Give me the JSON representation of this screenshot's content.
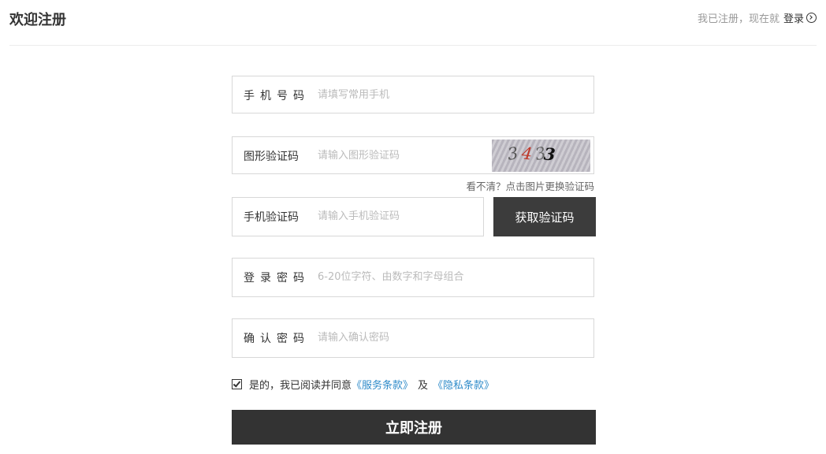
{
  "header": {
    "title": "欢迎注册",
    "login_prompt": "我已注册，现在就",
    "login_link": "登录",
    "login_icon": "arrow-circle-right-icon"
  },
  "form": {
    "phone": {
      "label": "手机号码",
      "placeholder": "请填写常用手机"
    },
    "captcha": {
      "label": "图形验证码",
      "placeholder": "请输入图形验证码",
      "image_text": "3433",
      "refresh_tip": "看不清？点击图片更换验证码"
    },
    "sms": {
      "label": "手机验证码",
      "placeholder": "请输入手机验证码",
      "button": "获取验证码"
    },
    "password": {
      "label": "登录密码",
      "placeholder": "6-20位字符、由数字和字母组合"
    },
    "confirm": {
      "label": "确认密码",
      "placeholder": "请输入确认密码"
    },
    "agreement": {
      "checked": true,
      "text": "是的，我已阅读并同意",
      "service_terms": "《服务条款》",
      "joiner": "及",
      "privacy_terms": "《隐私条款》"
    },
    "submit": "立即注册"
  },
  "colors": {
    "primary_button": "#333333",
    "link": "#2f8bc9",
    "border": "#d8d8d8"
  }
}
